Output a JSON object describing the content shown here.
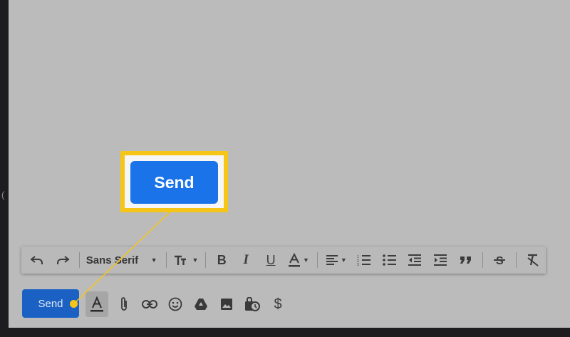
{
  "compose": {
    "send_label": "Send",
    "callout_send_label": "Send",
    "left_edge_glyph": "(",
    "toolbar": {
      "font_family_value": "Sans Serif",
      "items": [
        "undo-icon",
        "redo-icon",
        "font-family-select",
        "text-size-icon",
        "bold-icon",
        "italic-icon",
        "underline-icon",
        "text-color-icon",
        "align-icon",
        "numbered-list-icon",
        "bulleted-list-icon",
        "indent-less-icon",
        "indent-more-icon",
        "quote-icon",
        "strikethrough-icon",
        "remove-formatting-icon"
      ]
    },
    "bottom_icons": [
      "formatting-options-icon",
      "attach-file-icon",
      "insert-link-icon",
      "insert-emoji-icon",
      "google-drive-icon",
      "insert-photo-icon",
      "confidential-mode-icon",
      "dollar-icon"
    ],
    "colors": {
      "send_button": "#1a61c3",
      "callout_button": "#1a73e8",
      "callout_border": "#f5c518",
      "overlay_pane": "#bcbbbc"
    }
  }
}
